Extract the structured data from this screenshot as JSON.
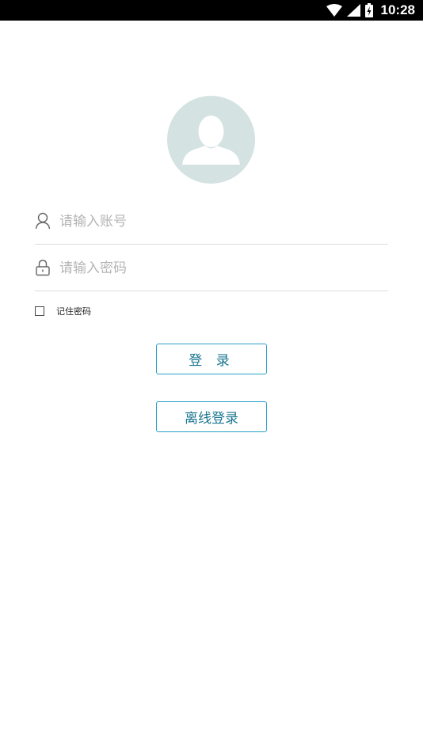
{
  "status_bar": {
    "time": "10:28",
    "icons": [
      "wifi-icon",
      "signal-icon",
      "battery-icon"
    ]
  },
  "avatar": {
    "icon": "user-avatar-icon",
    "color": "#d4e2e2"
  },
  "account": {
    "icon": "user-icon",
    "placeholder": "请输入账号",
    "value": ""
  },
  "password": {
    "icon": "lock-icon",
    "placeholder": "请输入密码",
    "value": ""
  },
  "remember": {
    "label": "记住密码",
    "checked": false
  },
  "buttons": {
    "login_label": "登 录",
    "offline_label": "离线登录"
  },
  "colors": {
    "accent_border": "#2aa0c8",
    "accent_text": "#1a7590",
    "placeholder": "#b4b4b4",
    "divider": "#dcdcdc"
  }
}
